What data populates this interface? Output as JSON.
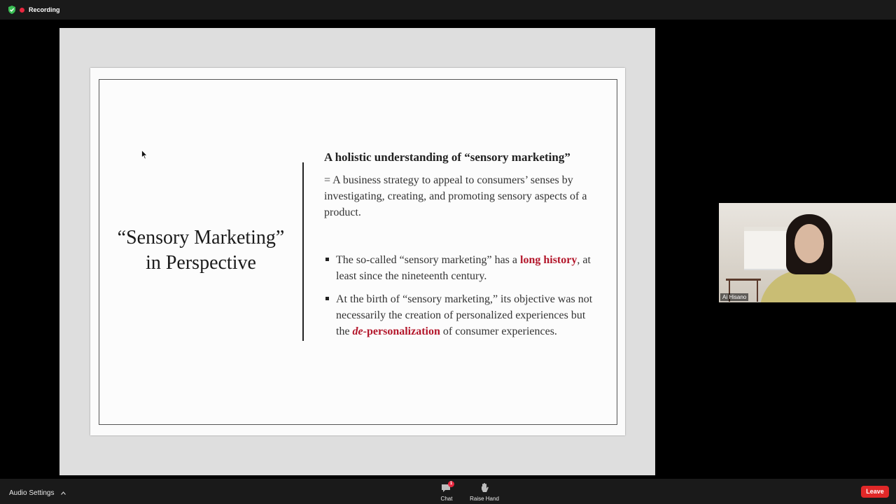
{
  "recording": {
    "label": "Recording"
  },
  "slide": {
    "title_line1": "“Sensory Marketing”",
    "title_line2": "in Perspective",
    "heading": "A holistic understanding of “sensory marketing”",
    "definition": " = A business strategy to appeal to consumers’ senses by investigating, creating, and promoting sensory aspects of a product.",
    "bullet1": {
      "before": "The so-called “sensory marketing” has a ",
      "highlight": "long history",
      "after": ", at least since the nineteenth century."
    },
    "bullet2": {
      "before": "At the birth of “sensory marketing,” its objective was not necessarily the creation of personalized experiences but the ",
      "highlight_italic": "de",
      "highlight": "-personalization",
      "after": " of consumer experiences."
    }
  },
  "participant": {
    "name": "Ai Hisano"
  },
  "toolbar": {
    "audio_settings": "Audio Settings",
    "chat_label": "Chat",
    "chat_badge": "1",
    "raise_hand_label": "Raise Hand",
    "leave_label": "Leave"
  },
  "colors": {
    "accent": "#b3172b",
    "leave": "#e02828",
    "recording": "#e8273f",
    "shield": "#3bbf55"
  },
  "icons": [
    "shield-check-icon",
    "recording-dot-icon",
    "chevron-up-icon",
    "chat-icon",
    "raise-hand-icon",
    "mouse-cursor-icon"
  ]
}
